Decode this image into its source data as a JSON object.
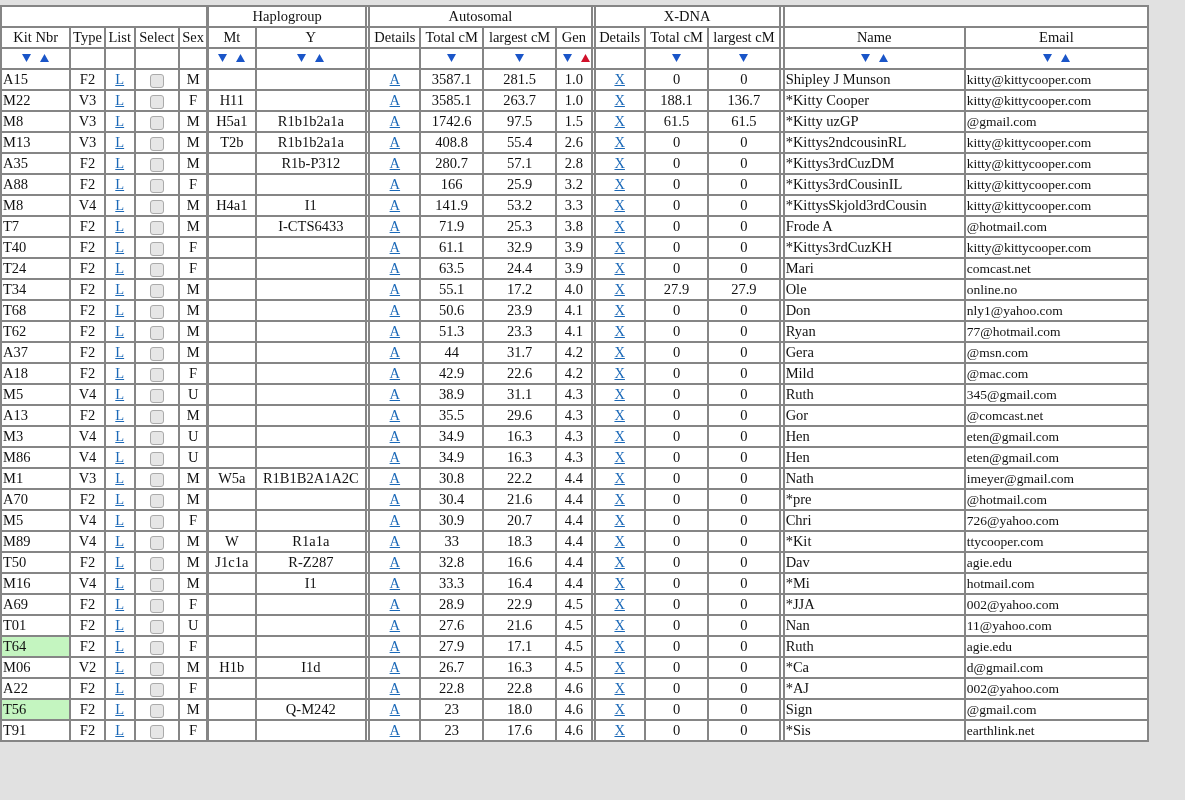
{
  "column_groups": [
    {
      "columns": [
        {
          "label": "Kit Nbr",
          "sort": [
            {
              "kind": "down",
              "active": false
            },
            {
              "kind": "up",
              "active": false
            }
          ]
        },
        {
          "label": "Type"
        },
        {
          "label": "List"
        },
        {
          "label": "Select"
        },
        {
          "label": "Sex"
        }
      ]
    },
    {
      "label": "Haplogroup",
      "columns": [
        {
          "label": "Mt",
          "sort": [
            {
              "kind": "down",
              "active": false
            },
            {
              "kind": "up",
              "active": false
            }
          ]
        },
        {
          "label": "Y",
          "sort": [
            {
              "kind": "down",
              "active": false
            },
            {
              "kind": "up",
              "active": false
            }
          ]
        }
      ]
    },
    {
      "label": "Autosomal",
      "columns": [
        {
          "label": "Details"
        },
        {
          "label": "Total cM",
          "sort": [
            {
              "kind": "down",
              "active": false
            }
          ]
        },
        {
          "label": "largest cM",
          "sort": [
            {
              "kind": "down",
              "active": false
            }
          ]
        },
        {
          "label": "Gen",
          "sort": [
            {
              "kind": "down",
              "active": false
            },
            {
              "kind": "up",
              "active": true
            }
          ]
        }
      ]
    },
    {
      "label": "X-DNA",
      "columns": [
        {
          "label": "Details"
        },
        {
          "label": "Total cM",
          "sort": [
            {
              "kind": "down",
              "active": false
            }
          ]
        },
        {
          "label": "largest cM",
          "sort": [
            {
              "kind": "down",
              "active": false
            }
          ]
        }
      ]
    },
    {
      "columns": [
        {
          "label": "Name",
          "sort": [
            {
              "kind": "down",
              "active": false
            },
            {
              "kind": "up",
              "active": false
            }
          ]
        },
        {
          "label": "Email",
          "sort": [
            {
              "kind": "down",
              "active": false
            },
            {
              "kind": "up",
              "active": false
            }
          ]
        }
      ]
    }
  ],
  "rows": [
    {
      "kit": "A15",
      "highlighted": false,
      "type": "F2",
      "list": "L",
      "checked": false,
      "sex": "M",
      "details": "A",
      "total_cm": "3587.1",
      "largest_cm": "281.5",
      "gen": "1.0",
      "x_details": "X",
      "x_total_cm": "0",
      "x_largest_cm": "0",
      "name": "Shipley J Munson",
      "email": "kitty@kittycooper.com"
    },
    {
      "kit": "M22",
      "highlighted": false,
      "type": "V3",
      "list": "L",
      "checked": false,
      "sex": "F",
      "mt": "H11",
      "details": "A",
      "total_cm": "3585.1",
      "largest_cm": "263.7",
      "gen": "1.0",
      "x_details": "X",
      "x_total_cm": "188.1",
      "x_largest_cm": "136.7",
      "name": "*Kitty Cooper",
      "email": "kitty@kittycooper.com"
    },
    {
      "kit": "M8",
      "highlighted": false,
      "type": "V3",
      "list": "L",
      "checked": false,
      "sex": "M",
      "mt": "H5a1",
      "y": "R1b1b2a1a",
      "details": "A",
      "total_cm": "1742.6",
      "largest_cm": "97.5",
      "gen": "1.5",
      "x_details": "X",
      "x_total_cm": "61.5",
      "x_largest_cm": "61.5",
      "name": "*Kitty uzGP",
      "email": "@gmail.com"
    },
    {
      "kit": "M13",
      "highlighted": false,
      "type": "V3",
      "list": "L",
      "checked": false,
      "sex": "M",
      "mt": "T2b",
      "y": "R1b1b2a1a",
      "details": "A",
      "total_cm": "408.8",
      "largest_cm": "55.4",
      "gen": "2.6",
      "x_details": "X",
      "x_total_cm": "0",
      "x_largest_cm": "0",
      "name": "*Kittys2ndcousinRL",
      "email": "kitty@kittycooper.com"
    },
    {
      "kit": "A35",
      "highlighted": false,
      "type": "F2",
      "list": "L",
      "checked": false,
      "sex": "M",
      "y": "R1b-P312",
      "details": "A",
      "total_cm": "280.7",
      "largest_cm": "57.1",
      "gen": "2.8",
      "x_details": "X",
      "x_total_cm": "0",
      "x_largest_cm": "0",
      "name": "*Kittys3rdCuzDM",
      "email": "kitty@kittycooper.com"
    },
    {
      "kit": "A88",
      "highlighted": false,
      "type": "F2",
      "list": "L",
      "checked": false,
      "sex": "F",
      "details": "A",
      "total_cm": "166",
      "largest_cm": "25.9",
      "gen": "3.2",
      "x_details": "X",
      "x_total_cm": "0",
      "x_largest_cm": "0",
      "name": "*Kittys3rdCousinIL",
      "email": "kitty@kittycooper.com"
    },
    {
      "kit": "M8",
      "highlighted": false,
      "type": "V4",
      "list": "L",
      "checked": false,
      "sex": "M",
      "mt": "H4a1",
      "y": "I1",
      "details": "A",
      "total_cm": "141.9",
      "largest_cm": "53.2",
      "gen": "3.3",
      "x_details": "X",
      "x_total_cm": "0",
      "x_largest_cm": "0",
      "name": "*KittysSkjold3rdCousin",
      "email": "kitty@kittycooper.com"
    },
    {
      "kit": "T7",
      "highlighted": false,
      "type": "F2",
      "list": "L",
      "checked": false,
      "sex": "M",
      "y": "I-CTS6433",
      "details": "A",
      "total_cm": "71.9",
      "largest_cm": "25.3",
      "gen": "3.8",
      "x_details": "X",
      "x_total_cm": "0",
      "x_largest_cm": "0",
      "name": "Frode A",
      "email": "@hotmail.com"
    },
    {
      "kit": "T40",
      "highlighted": false,
      "type": "F2",
      "list": "L",
      "checked": false,
      "sex": "F",
      "details": "A",
      "total_cm": "61.1",
      "largest_cm": "32.9",
      "gen": "3.9",
      "x_details": "X",
      "x_total_cm": "0",
      "x_largest_cm": "0",
      "name": "*Kittys3rdCuzKH",
      "email": "kitty@kittycooper.com"
    },
    {
      "kit": "T24",
      "highlighted": false,
      "type": "F2",
      "list": "L",
      "checked": false,
      "sex": "F",
      "details": "A",
      "total_cm": "63.5",
      "largest_cm": "24.4",
      "gen": "3.9",
      "x_details": "X",
      "x_total_cm": "0",
      "x_largest_cm": "0",
      "name": "Mari",
      "email": "comcast.net"
    },
    {
      "kit": "T34",
      "highlighted": false,
      "type": "F2",
      "list": "L",
      "checked": false,
      "sex": "M",
      "details": "A",
      "total_cm": "55.1",
      "largest_cm": "17.2",
      "gen": "4.0",
      "x_details": "X",
      "x_total_cm": "27.9",
      "x_largest_cm": "27.9",
      "name": "Ole",
      "email": "online.no"
    },
    {
      "kit": "T68",
      "highlighted": false,
      "type": "F2",
      "list": "L",
      "checked": false,
      "sex": "M",
      "details": "A",
      "total_cm": "50.6",
      "largest_cm": "23.9",
      "gen": "4.1",
      "x_details": "X",
      "x_total_cm": "0",
      "x_largest_cm": "0",
      "name": "Don",
      "email": "nly1@yahoo.com"
    },
    {
      "kit": "T62",
      "highlighted": false,
      "type": "F2",
      "list": "L",
      "checked": false,
      "sex": "M",
      "details": "A",
      "total_cm": "51.3",
      "largest_cm": "23.3",
      "gen": "4.1",
      "x_details": "X",
      "x_total_cm": "0",
      "x_largest_cm": "0",
      "name": "Ryan",
      "email": "77@hotmail.com"
    },
    {
      "kit": "A37",
      "highlighted": false,
      "type": "F2",
      "list": "L",
      "checked": false,
      "sex": "M",
      "details": "A",
      "total_cm": "44",
      "largest_cm": "31.7",
      "gen": "4.2",
      "x_details": "X",
      "x_total_cm": "0",
      "x_largest_cm": "0",
      "name": "Gera",
      "email": "@msn.com"
    },
    {
      "kit": "A18",
      "highlighted": false,
      "type": "F2",
      "list": "L",
      "checked": false,
      "sex": "F",
      "details": "A",
      "total_cm": "42.9",
      "largest_cm": "22.6",
      "gen": "4.2",
      "x_details": "X",
      "x_total_cm": "0",
      "x_largest_cm": "0",
      "name": "Mild",
      "email": "@mac.com"
    },
    {
      "kit": "M5",
      "highlighted": false,
      "type": "V4",
      "list": "L",
      "checked": false,
      "sex": "U",
      "details": "A",
      "total_cm": "38.9",
      "largest_cm": "31.1",
      "gen": "4.3",
      "x_details": "X",
      "x_total_cm": "0",
      "x_largest_cm": "0",
      "name": "Ruth",
      "email": "345@gmail.com"
    },
    {
      "kit": "A13",
      "highlighted": false,
      "type": "F2",
      "list": "L",
      "checked": false,
      "sex": "M",
      "details": "A",
      "total_cm": "35.5",
      "largest_cm": "29.6",
      "gen": "4.3",
      "x_details": "X",
      "x_total_cm": "0",
      "x_largest_cm": "0",
      "name": "Gor",
      "email": "@comcast.net"
    },
    {
      "kit": "M3",
      "highlighted": false,
      "type": "V4",
      "list": "L",
      "checked": false,
      "sex": "U",
      "details": "A",
      "total_cm": "34.9",
      "largest_cm": "16.3",
      "gen": "4.3",
      "x_details": "X",
      "x_total_cm": "0",
      "x_largest_cm": "0",
      "name": "Hen",
      "email": "eten@gmail.com"
    },
    {
      "kit": "M86",
      "highlighted": false,
      "type": "V4",
      "list": "L",
      "checked": false,
      "sex": "U",
      "details": "A",
      "total_cm": "34.9",
      "largest_cm": "16.3",
      "gen": "4.3",
      "x_details": "X",
      "x_total_cm": "0",
      "x_largest_cm": "0",
      "name": "Hen",
      "email": "eten@gmail.com"
    },
    {
      "kit": "M1",
      "highlighted": false,
      "type": "V3",
      "list": "L",
      "checked": false,
      "sex": "M",
      "mt": "W5a",
      "y": "R1B1B2A1A2C",
      "details": "A",
      "total_cm": "30.8",
      "largest_cm": "22.2",
      "gen": "4.4",
      "x_details": "X",
      "x_total_cm": "0",
      "x_largest_cm": "0",
      "name": "Nath",
      "email": "imeyer@gmail.com"
    },
    {
      "kit": "A70",
      "highlighted": false,
      "type": "F2",
      "list": "L",
      "checked": false,
      "sex": "M",
      "details": "A",
      "total_cm": "30.4",
      "largest_cm": "21.6",
      "gen": "4.4",
      "x_details": "X",
      "x_total_cm": "0",
      "x_largest_cm": "0",
      "name": "*pre",
      "email": "@hotmail.com"
    },
    {
      "kit": "M5",
      "highlighted": false,
      "type": "V4",
      "list": "L",
      "checked": false,
      "sex": "F",
      "details": "A",
      "total_cm": "30.9",
      "largest_cm": "20.7",
      "gen": "4.4",
      "x_details": "X",
      "x_total_cm": "0",
      "x_largest_cm": "0",
      "name": "Chri",
      "email": "726@yahoo.com"
    },
    {
      "kit": "M89",
      "highlighted": false,
      "type": "V4",
      "list": "L",
      "checked": false,
      "sex": "M",
      "mt": "W",
      "y": "R1a1a",
      "details": "A",
      "total_cm": "33",
      "largest_cm": "18.3",
      "gen": "4.4",
      "x_details": "X",
      "x_total_cm": "0",
      "x_largest_cm": "0",
      "name": "*Kit",
      "email": "ttycooper.com"
    },
    {
      "kit": "T50",
      "highlighted": false,
      "type": "F2",
      "list": "L",
      "checked": false,
      "sex": "M",
      "mt": "J1c1a",
      "y": "R-Z287",
      "details": "A",
      "total_cm": "32.8",
      "largest_cm": "16.6",
      "gen": "4.4",
      "x_details": "X",
      "x_total_cm": "0",
      "x_largest_cm": "0",
      "name": "Dav",
      "email": "agie.edu"
    },
    {
      "kit": "M16",
      "highlighted": false,
      "type": "V4",
      "list": "L",
      "checked": false,
      "sex": "M",
      "y": "I1",
      "details": "A",
      "total_cm": "33.3",
      "largest_cm": "16.4",
      "gen": "4.4",
      "x_details": "X",
      "x_total_cm": "0",
      "x_largest_cm": "0",
      "name": "*Mi",
      "email": "hotmail.com"
    },
    {
      "kit": "A69",
      "highlighted": false,
      "type": "F2",
      "list": "L",
      "checked": false,
      "sex": "F",
      "details": "A",
      "total_cm": "28.9",
      "largest_cm": "22.9",
      "gen": "4.5",
      "x_details": "X",
      "x_total_cm": "0",
      "x_largest_cm": "0",
      "name": "*JJA",
      "email": "002@yahoo.com"
    },
    {
      "kit": "T01",
      "highlighted": false,
      "type": "F2",
      "list": "L",
      "checked": false,
      "sex": "U",
      "details": "A",
      "total_cm": "27.6",
      "largest_cm": "21.6",
      "gen": "4.5",
      "x_details": "X",
      "x_total_cm": "0",
      "x_largest_cm": "0",
      "name": "Nan",
      "email": "11@yahoo.com"
    },
    {
      "kit": "T64",
      "highlighted": true,
      "type": "F2",
      "list": "L",
      "checked": false,
      "sex": "F",
      "details": "A",
      "total_cm": "27.9",
      "largest_cm": "17.1",
      "gen": "4.5",
      "x_details": "X",
      "x_total_cm": "0",
      "x_largest_cm": "0",
      "name": "Ruth",
      "email": "agie.edu"
    },
    {
      "kit": "M06",
      "highlighted": false,
      "type": "V2",
      "list": "L",
      "checked": false,
      "sex": "M",
      "mt": "H1b",
      "y": "I1d",
      "details": "A",
      "total_cm": "26.7",
      "largest_cm": "16.3",
      "gen": "4.5",
      "x_details": "X",
      "x_total_cm": "0",
      "x_largest_cm": "0",
      "name": "*Ca",
      "email": "d@gmail.com"
    },
    {
      "kit": "A22",
      "highlighted": false,
      "type": "F2",
      "list": "L",
      "checked": false,
      "sex": "F",
      "details": "A",
      "total_cm": "22.8",
      "largest_cm": "22.8",
      "gen": "4.6",
      "x_details": "X",
      "x_total_cm": "0",
      "x_largest_cm": "0",
      "name": "*AJ",
      "email": "002@yahoo.com"
    },
    {
      "kit": "T56",
      "highlighted": true,
      "type": "F2",
      "list": "L",
      "checked": false,
      "sex": "M",
      "y": "Q-M242",
      "details": "A",
      "total_cm": "23",
      "largest_cm": "18.0",
      "gen": "4.6",
      "x_details": "X",
      "x_total_cm": "0",
      "x_largest_cm": "0",
      "name": "Sign",
      "email": "@gmail.com"
    },
    {
      "kit": "T91",
      "highlighted": false,
      "type": "F2",
      "list": "L",
      "checked": false,
      "sex": "F",
      "details": "A",
      "total_cm": "23",
      "largest_cm": "17.6",
      "gen": "4.6",
      "x_details": "X",
      "x_total_cm": "0",
      "x_largest_cm": "0",
      "name": "*Sis",
      "email": "earthlink.net"
    }
  ]
}
